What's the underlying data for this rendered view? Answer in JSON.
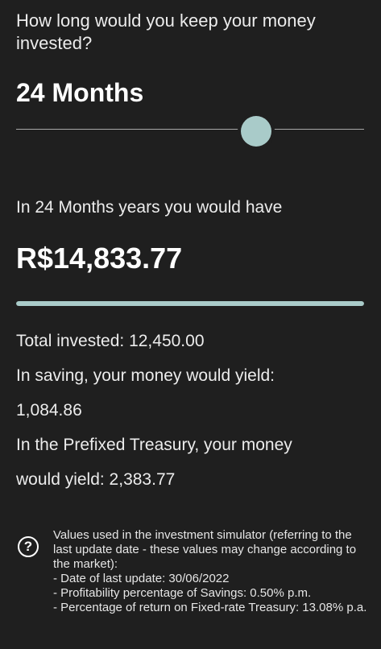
{
  "question": "How long would you keep your money invested?",
  "duration": {
    "label": "24 Months",
    "slider_fraction": 0.69
  },
  "result": {
    "intro": "In 24 Months years you would have",
    "amount": "R$14,833.77",
    "bar_fraction": 1.0
  },
  "details": [
    "Total invested: 12,450.00",
    "In saving, your money would yield:",
    "1,084.86",
    "In the Prefixed Treasury, your money",
    "would yield: 2,383.77"
  ],
  "info": {
    "icon": "question-icon",
    "lines": [
      "Values used in the investment simulator (referring to the last update date - these values may change according to the market):",
      "- Date of last update: 30/06/2022",
      "- Profitability percentage of Savings: 0.50% p.m.",
      "- Percentage of return on Fixed-rate Treasury: 13.08% p.a."
    ]
  },
  "colors": {
    "background": "#1f1f1f",
    "accent": "#a9cbc9",
    "text": "#ececec"
  }
}
